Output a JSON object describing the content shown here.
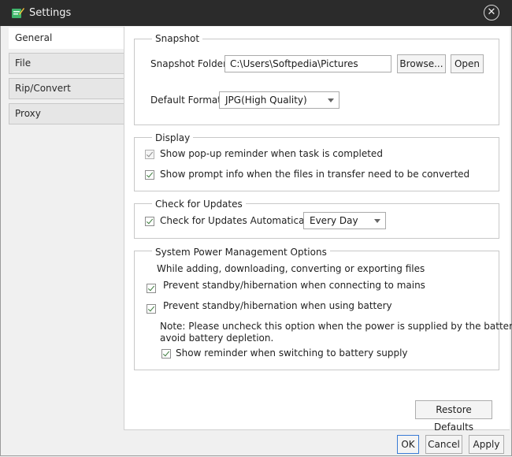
{
  "window": {
    "title": "Settings"
  },
  "tabs": [
    {
      "label": "General",
      "active": true
    },
    {
      "label": "File",
      "active": false
    },
    {
      "label": "Rip/Convert",
      "active": false
    },
    {
      "label": "Proxy",
      "active": false
    }
  ],
  "snapshot": {
    "legend": "Snapshot",
    "folder_label": "Snapshot Folder:",
    "folder_value": "C:\\Users\\Softpedia\\Pictures",
    "browse_label": "Browse...",
    "open_label": "Open",
    "format_label": "Default Format:",
    "format_value": "JPG(High Quality)"
  },
  "display": {
    "legend": "Display",
    "popup_label": "Show pop-up reminder when task is completed",
    "popup_checked": true,
    "prompt_label": "Show prompt info when the files in transfer need to be converted",
    "prompt_checked": true
  },
  "updates": {
    "legend": "Check for Updates",
    "auto_label": "Check for Updates Automatically:",
    "auto_checked": true,
    "frequency_value": "Every Day"
  },
  "power": {
    "legend": "System Power Management Options",
    "intro": "While adding, downloading, converting or exporting files",
    "mains_label": "Prevent standby/hibernation when connecting to mains",
    "mains_checked": true,
    "battery_label": "Prevent standby/hibernation when using battery",
    "battery_checked": true,
    "note_line1": "Note: Please uncheck this option when the power is supplied by the battery to",
    "note_line2": "avoid battery depletion.",
    "reminder_label": "Show reminder when switching to battery supply",
    "reminder_checked": true
  },
  "restore_label": "Restore Defaults",
  "footer": {
    "ok_label": "OK",
    "cancel_label": "Cancel",
    "apply_label": "Apply"
  },
  "icons": {
    "app": "app-icon",
    "close": "close-icon",
    "dropdown": "chevron-down-icon",
    "check": "checkmark-icon"
  },
  "colors": {
    "titlebar": "#2b2b2b",
    "pane": "#ffffff",
    "check": "#3b7a3b"
  }
}
